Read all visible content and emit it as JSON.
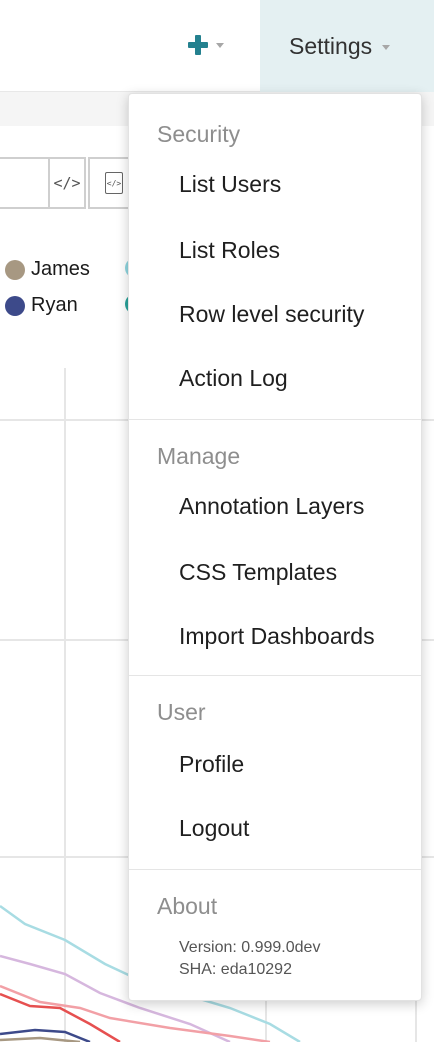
{
  "navbar": {
    "add_icon": "plus-icon",
    "caret_icon": "caret-down-icon",
    "settings_label": "Settings",
    "plus_color": "#24818f",
    "settings_active_bg": "#e4f0f2"
  },
  "toolbar": {
    "buttons": [
      {
        "icon": "",
        "name": "toolbar-button"
      },
      {
        "icon": "</>",
        "name": "embed-code-icon"
      },
      {
        "icon": "</>",
        "name": "file-code-icon"
      }
    ]
  },
  "legend": {
    "items": [
      {
        "label": "James",
        "color": "#a79882"
      },
      {
        "label": "Ryan",
        "color": "#3d4a8a"
      }
    ],
    "partial_colors": [
      "#8fd6e0",
      "#2aa39b"
    ]
  },
  "menu": {
    "sections": [
      {
        "header": "Security",
        "items": [
          "List Users",
          "List Roles",
          "Row level security",
          "Action Log"
        ]
      },
      {
        "header": "Manage",
        "items": [
          "Annotation Layers",
          "CSS Templates",
          "Import Dashboards"
        ]
      },
      {
        "header": "User",
        "items": [
          "Profile",
          "Logout"
        ]
      },
      {
        "header": "About",
        "version": "Version: 0.999.0dev",
        "sha": "SHA: eda10292"
      }
    ]
  }
}
